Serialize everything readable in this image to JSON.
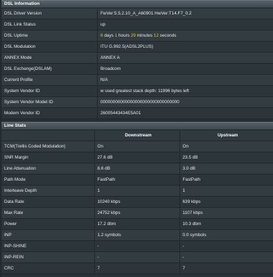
{
  "dsl_info": {
    "title": "DSL Information",
    "rows": [
      {
        "label": "DSL Driver Version",
        "value": "FwVer:5.5.2.10_A_A60901 HwVer:T14.F7_0.2"
      },
      {
        "label": "DSL Link Status",
        "value": "up"
      },
      {
        "label": "DSL Uptime",
        "uptime": {
          "days": "6",
          "days_unit": " days ",
          "hours": "1",
          "hours_unit": " hours ",
          "minutes": "29",
          "minutes_unit": " minutes ",
          "seconds": "12",
          "seconds_unit": " seconds"
        }
      },
      {
        "label": "DSL Modulation",
        "value": "ITU G.992.5(ADSL2PLUS)"
      },
      {
        "label": "ANNEX Mode",
        "value": "ANNEX A"
      },
      {
        "label": "DSL Exchange(DSLAM)",
        "value": "Broadcom"
      },
      {
        "label": "Current Profile",
        "value": "N/A"
      },
      {
        "label": "System Vendor ID",
        "value": "w used greatest stack depth: 11996 bytes left"
      },
      {
        "label": "System Vendor Model ID",
        "value": "00000000000000000000000000000000"
      },
      {
        "label": "Modem Vendor ID",
        "value": "26005443434E5A01"
      }
    ]
  },
  "line_stats": {
    "title": "Line Stats",
    "col_downstream": "Downstream",
    "col_upstream": "Upstream",
    "rows": [
      {
        "label": "TCM(Trellis Coded Modulation)",
        "down": "On",
        "up": "On"
      },
      {
        "label": "SNR Margin",
        "down": "27.6 dB",
        "up": "23.5 dB"
      },
      {
        "label": "Line Attenuation",
        "down": "8.6 dB",
        "up": "3.0 dB"
      },
      {
        "label": "Path Mode",
        "down": "FastPath",
        "up": "FastPath"
      },
      {
        "label": "Interleave Depth",
        "down": "1",
        "up": "1"
      },
      {
        "label": "Data Rate",
        "down": "10240 kbps",
        "up": "639 kbps"
      },
      {
        "label": "Max Rate",
        "down": "24752 kbps",
        "up": "1107 kbps"
      },
      {
        "label": "Power",
        "down": "17.2 dbm",
        "up": "10.3 dbm"
      },
      {
        "label": "INP",
        "down": "1.2 symbols",
        "up": "0.0 symbols"
      },
      {
        "label": "INP-SHINE",
        "down": "-",
        "up": "-"
      },
      {
        "label": "INP-REIN",
        "down": "-",
        "up": "-"
      },
      {
        "label": "CRC",
        "down": "7",
        "up": "7"
      }
    ]
  },
  "colors": {
    "highlight": "#f5c31c",
    "background": "#2a3236",
    "header": "#4a555d"
  }
}
